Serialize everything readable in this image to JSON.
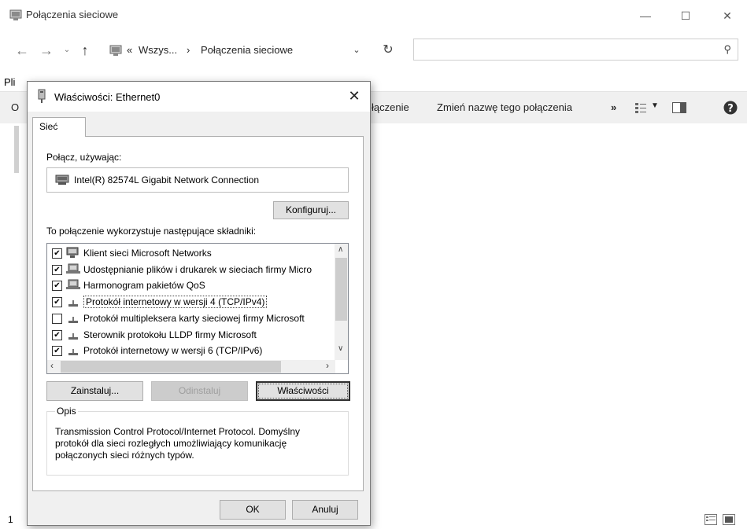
{
  "explorer": {
    "title": "Połączenia sieciowe",
    "address": {
      "prefix": "«",
      "crumb1": "Wszys...",
      "separator": "›",
      "crumb2": "Połączenia sieciowe"
    },
    "menu_fragment": "Pli",
    "toolbar": {
      "left_fragment": "O",
      "partial_action": "łączenie",
      "rename_action": "Zmień nazwę tego połączenia",
      "more": "»"
    },
    "left_marker": "1",
    "icons": [
      "network-folder-icon",
      "back-arrow-icon",
      "forward-arrow-icon",
      "up-arrow-icon",
      "refresh-icon",
      "search-icon",
      "view-options-icon",
      "preview-pane-icon",
      "help-icon",
      "details-view-icon",
      "large-icons-view-icon"
    ]
  },
  "dialog": {
    "title": "Właściwości: Ethernet0",
    "tab_label": "Sieć",
    "connect_using_label": "Połącz, używając:",
    "adapter_name": "Intel(R) 82574L Gigabit Network Connection",
    "configure_label": "Konfiguruj...",
    "components_label": "To połączenie wykorzystuje następujące składniki:",
    "components": [
      {
        "label": "Klient sieci Microsoft Networks",
        "checked": true,
        "icon": "network-client-icon"
      },
      {
        "label": "Udostępnianie plików i drukarek w sieciach firmy Micro",
        "checked": true,
        "icon": "network-service-icon"
      },
      {
        "label": "Harmonogram pakietów QoS",
        "checked": true,
        "icon": "network-service-icon"
      },
      {
        "label": "Protokół internetowy w wersji 4 (TCP/IPv4)",
        "checked": true,
        "icon": "protocol-icon",
        "selected": true
      },
      {
        "label": "Protokół multipleksera karty sieciowej firmy Microsoft",
        "checked": false,
        "icon": "protocol-icon"
      },
      {
        "label": "Sterownik protokołu LLDP firmy Microsoft",
        "checked": true,
        "icon": "protocol-icon"
      },
      {
        "label": "Protokół internetowy w wersji 6 (TCP/IPv6)",
        "checked": true,
        "icon": "protocol-icon"
      }
    ],
    "install_label": "Zainstaluj...",
    "uninstall_label": "Odinstaluj",
    "properties_label": "Właściwości",
    "description_legend": "Opis",
    "description_text": "Transmission Control Protocol/Internet Protocol. Domyślny protokół dla sieci rozległych umożliwiający komunikację połączonych sieci różnych typów.",
    "ok_label": "OK",
    "cancel_label": "Anuluj"
  },
  "colors": {
    "dialog_bg": "#f0f0f0",
    "panel_bg": "#ffffff",
    "button_bg": "#e1e1e1",
    "disabled_text": "#9e9e9e"
  }
}
